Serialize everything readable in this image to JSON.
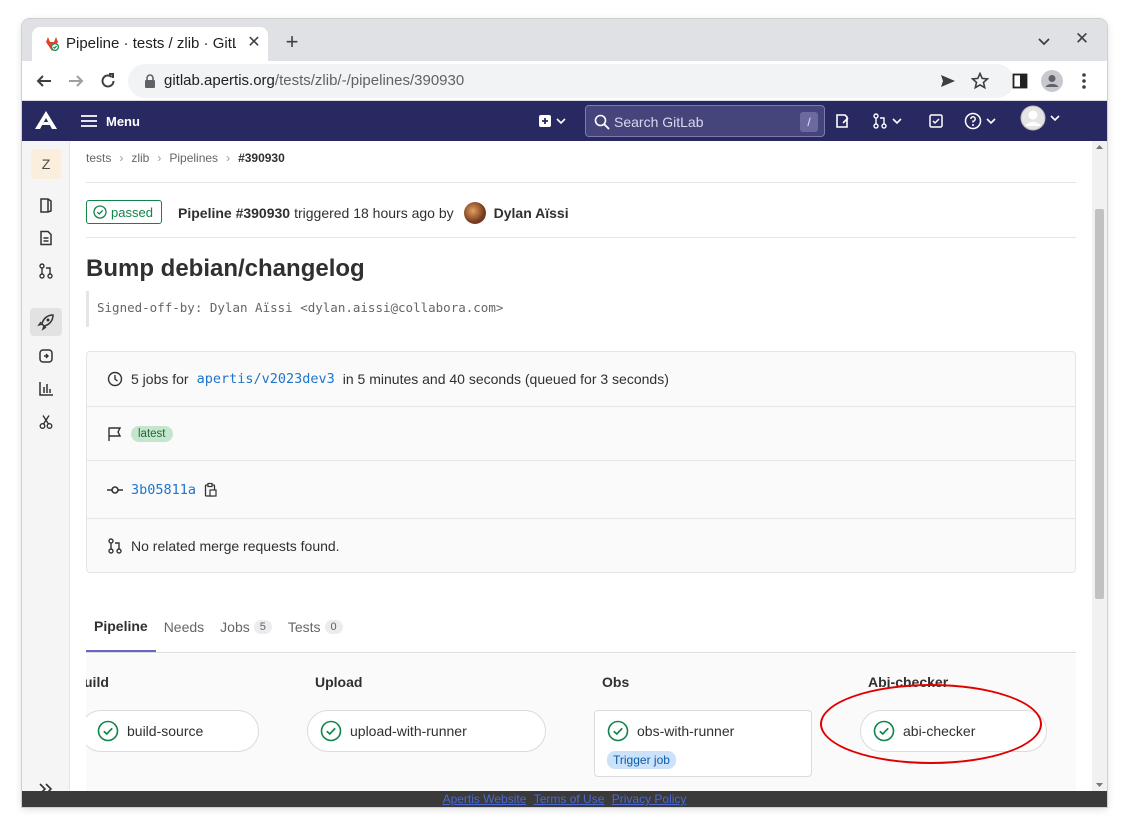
{
  "browser": {
    "tab_title": "Pipeline · tests / zlib · GitLab",
    "url_host": "gitlab.apertis.org",
    "url_path": "/tests/zlib/-/pipelines/390930"
  },
  "header": {
    "menu_label": "Menu",
    "search_placeholder": "Search GitLab",
    "search_shortcut": "/"
  },
  "sidebar": {
    "project_initial": "Z",
    "items": [
      "project-overview",
      "repository",
      "merge-requests",
      "ci-cd",
      "deployments",
      "analytics",
      "snippets"
    ]
  },
  "breadcrumb": {
    "items": [
      "tests",
      "zlib",
      "Pipelines",
      "#390930"
    ]
  },
  "pipeline": {
    "status": "passed",
    "id_label": "Pipeline #390930",
    "triggered_text": "triggered 18 hours ago by",
    "user_name": "Dylan Aïssi",
    "commit_title": "Bump debian/changelog",
    "commit_description": "Signed-off-by: Dylan Aïssi <dylan.aissi@collabora.com>",
    "jobs_prefix": "5 jobs for",
    "branch": "apertis/v2023dev3",
    "duration_text": "in 5 minutes and 40 seconds (queued for 3 seconds)",
    "latest_badge": "latest",
    "commit_sha": "3b05811a",
    "merge_requests_text": "No related merge requests found."
  },
  "tabs": [
    {
      "label": "Pipeline",
      "count": null
    },
    {
      "label": "Needs",
      "count": null
    },
    {
      "label": "Jobs",
      "count": "5"
    },
    {
      "label": "Tests",
      "count": "0"
    }
  ],
  "stages": [
    {
      "title": "uild",
      "job": "build-source"
    },
    {
      "title": "Upload",
      "job": "upload-with-runner"
    },
    {
      "title": "Obs",
      "job": "obs-with-runner",
      "badge": "Trigger job"
    },
    {
      "title": "Abi-checker",
      "job": "abi-checker"
    }
  ],
  "footer": {
    "links": [
      "Apertis Website",
      "Terms of Use",
      "Privacy Policy"
    ]
  },
  "colors": {
    "header_bg": "#292961",
    "success": "#108548",
    "link": "#1f75cb",
    "highlight": "#e00000"
  }
}
